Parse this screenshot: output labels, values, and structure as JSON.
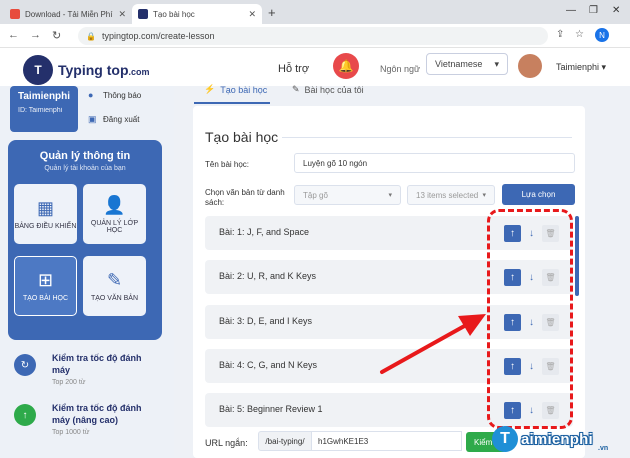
{
  "browser": {
    "tabs": [
      {
        "label": "Download - Tải Miễn Phí VN - Ph...",
        "close": "✕",
        "favicon_color": "#e84c3d"
      },
      {
        "label": "Tạo bài học",
        "close": "✕",
        "favicon_color": "#24306b"
      }
    ],
    "new_tab": "+",
    "url": "typingtop.com/create-lesson",
    "profile_letter": "N"
  },
  "header": {
    "logo_mark": "T",
    "logo_text": "Typing top",
    "logo_suffix": ".com",
    "support": "Hỗ trợ",
    "language_label": "Ngôn ngữ",
    "language_value": "Vietnamese",
    "username": "Taimienphi"
  },
  "sidebar": {
    "user_name": "Taimienphi",
    "user_id": "ID: Taimienphi",
    "notifications": "Thông báo",
    "logout": "Đăng xuất",
    "mgmt_title": "Quản lý thông tin",
    "mgmt_sub": "Quản lý tài khoản của bạn",
    "tiles": [
      {
        "label": "BẢNG ĐIỀU KHIỂN",
        "icon": "dashboard-icon"
      },
      {
        "label": "QUẢN LÝ LỚP HỌC",
        "icon": "class-manage-icon"
      },
      {
        "label": "TẠO BÀI HỌC",
        "icon": "create-lesson-icon"
      },
      {
        "label": "TẠO VĂN BẢN",
        "icon": "create-text-icon"
      }
    ],
    "tests": [
      {
        "title": "Kiểm tra tốc độ đánh máy",
        "sub": "Top 200 từ",
        "color": "#3d68b4"
      },
      {
        "title": "Kiểm tra tốc độ đánh máy (nâng cao)",
        "sub": "Top 1000 từ",
        "color": "#2eaa4a"
      }
    ]
  },
  "main": {
    "tab_create": "Tạo bài học",
    "tab_mine": "Bài học của tôi",
    "title": "Tạo bài học",
    "lesson_name_label": "Tên bài học:",
    "lesson_name_value": "Luyện gõ 10 ngón",
    "choose_text_label": "Chọn văn bản từ danh sách:",
    "set_placeholder": "Tập gõ",
    "items_selected": "13 items selected",
    "choose_button": "Lựa chọn",
    "lessons": [
      "Bài: 1: J, F, and Space",
      "Bài: 2: U, R, and K Keys",
      "Bài: 3: D, E, and I Keys",
      "Bài: 4: C, G, and N Keys",
      "Bài: 5: Beginner Review 1"
    ],
    "short_url_label": "URL ngắn:",
    "short_url_prefix": "/bai-typing/",
    "short_url_value": "h1GwhKE1E3",
    "check_button": "Kiểm tra"
  },
  "watermark": {
    "text": "aimienphi",
    "mark": "T",
    "suffix": ".vn"
  },
  "colors": {
    "accent": "#3d68b4",
    "brand_dark": "#24306b",
    "annotation_red": "#e8191b",
    "success": "#2eaa4a"
  }
}
